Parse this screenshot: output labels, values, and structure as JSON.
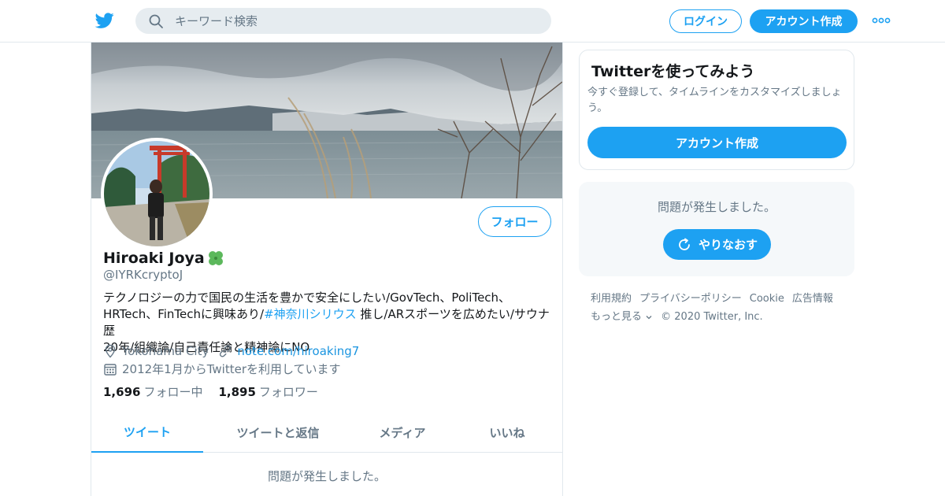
{
  "topbar": {
    "logo_icon": "twitter-bird-icon",
    "search_placeholder": "キーワード検索",
    "login_label": "ログイン",
    "signup_label": "アカウント作成",
    "more_icon": "more-dots-icon"
  },
  "profile": {
    "follow_label": "フォロー",
    "name": "Hiroaki Joya",
    "name_emoji_icon": "four-leaf-clover-icon",
    "handle": "@IYRKcryptoJ",
    "bio_part1": "テクノロジーの力で国民の生活を豊かで安全にしたい/GovTech、PoliTech、\nHRTech、FinTechに興味あり/",
    "bio_hashtag": "#神奈川シリウス",
    "bio_part2": " 推し/ARスポーツを広めたい/サウナ歴\n20年/組織論/自己責任論と精神論にNO",
    "location": "Yokohama City",
    "website": "note.com/hiroaking7",
    "joined": "2012年1月からTwitterを利用しています",
    "following_count": "1,696",
    "following_label": "フォロー中",
    "followers_count": "1,895",
    "followers_label": "フォロワー",
    "tabs": [
      {
        "label": "ツイート",
        "active": true
      },
      {
        "label": "ツイートと返信",
        "active": false
      },
      {
        "label": "メディア",
        "active": false
      },
      {
        "label": "いいね",
        "active": false
      }
    ],
    "feed_error": "問題が発生しました。"
  },
  "sidebar": {
    "join_title": "Twitterを使ってみよう",
    "join_text": "今すぐ登録して、タイムラインをカスタマイズしましょう。",
    "join_button": "アカウント作成",
    "error_message": "問題が発生しました。",
    "retry_label": "やりなおす"
  },
  "footer": {
    "links": [
      "利用規約",
      "プライバシーポリシー",
      "Cookie",
      "広告情報"
    ],
    "more_label": "もっと見る",
    "copyright": "© 2020 Twitter, Inc."
  },
  "colors": {
    "accent": "#1da1f2",
    "secondary_text": "#657786",
    "border": "#e1e8ed"
  }
}
